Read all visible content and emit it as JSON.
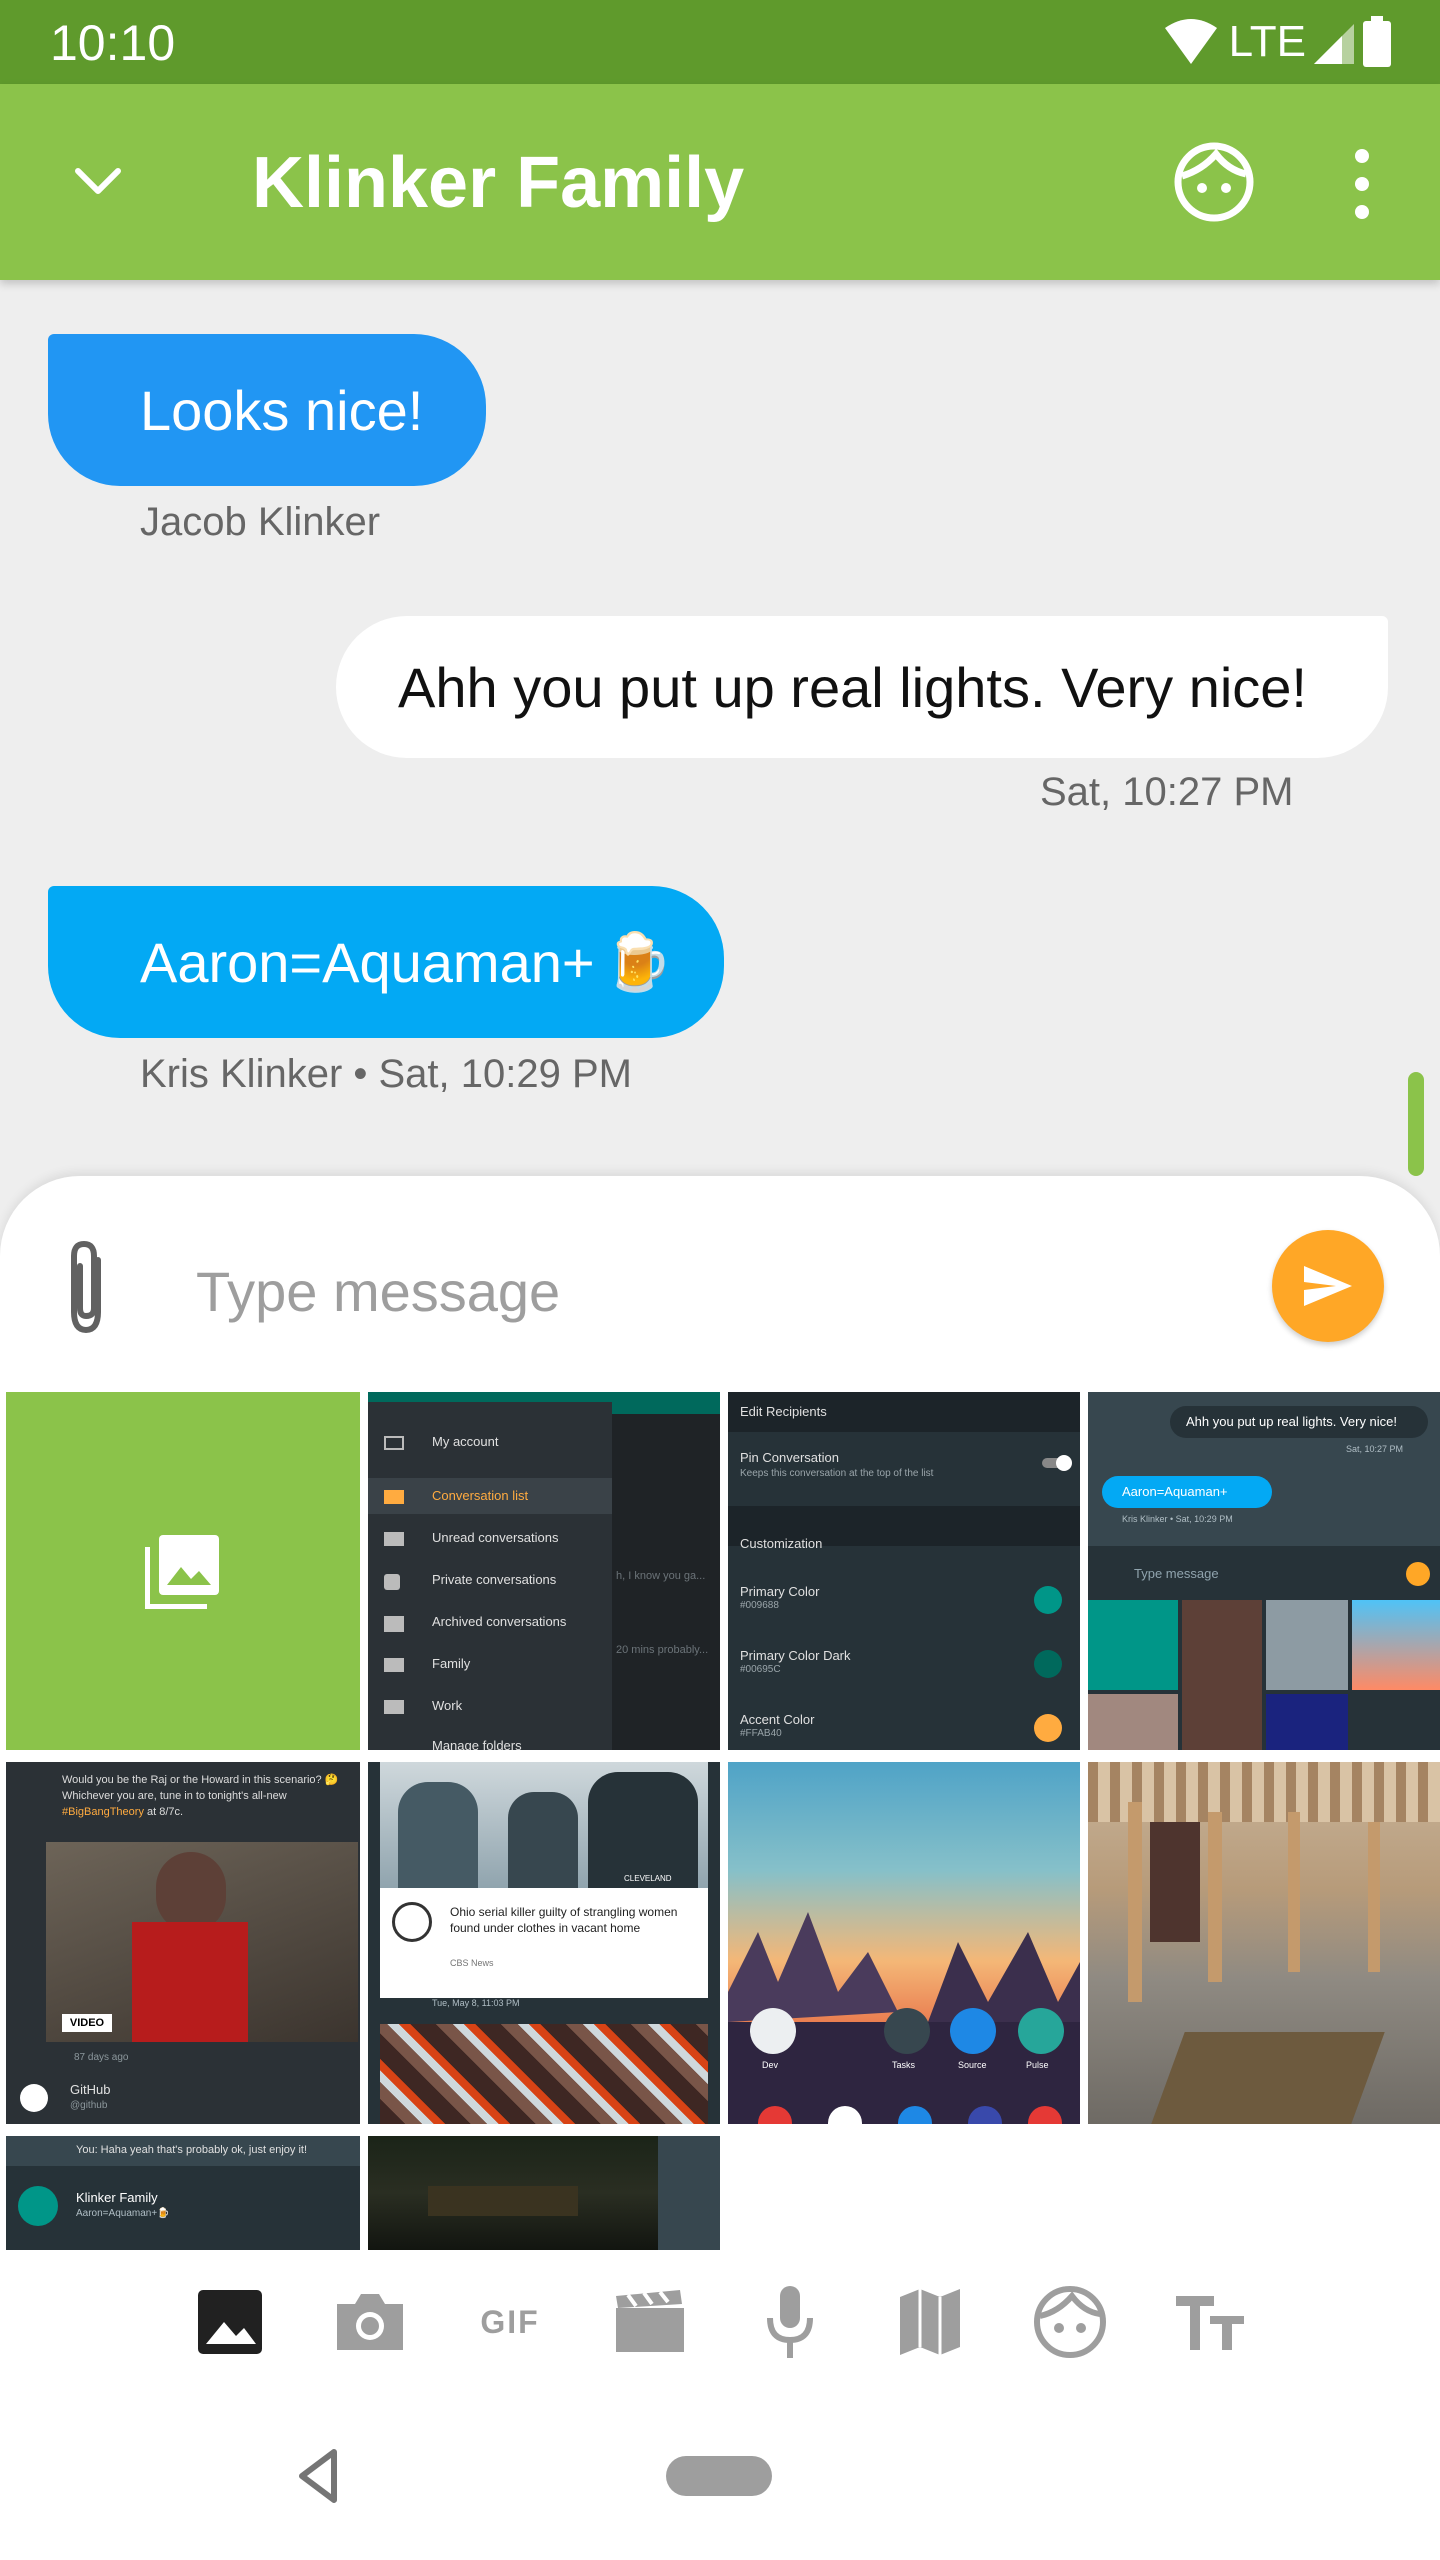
{
  "status_bar": {
    "time": "10:10",
    "network": "LTE"
  },
  "app_bar": {
    "title": "Klinker Family"
  },
  "messages": [
    {
      "text": "Looks nice!",
      "meta": "Jacob Klinker"
    },
    {
      "text": "Ahh you put up real lights. Very nice!",
      "meta": "Sat, 10:27 PM"
    },
    {
      "text": "Aaron=Aquaman+",
      "emoji": "🍺",
      "meta": "Kris Klinker • Sat, 10:29 PM"
    }
  ],
  "compose": {
    "placeholder": "Type message"
  },
  "gallery": {
    "settings_menu": [
      "My account",
      "Conversation list",
      "Unread conversations",
      "Private conversations",
      "Archived conversations",
      "Family",
      "Work",
      "Manage folders"
    ],
    "settings_menu_fragments": [
      "h, I know you ga...",
      "20 mins probably..."
    ],
    "conversation_settings": {
      "header": "Edit Recipients",
      "pin_title": "Pin Conversation",
      "pin_sub": "Keeps this conversation at the top of the list",
      "section": "Customization",
      "items": [
        {
          "label": "Primary Color",
          "value": "#009688",
          "color": "#009688"
        },
        {
          "label": "Primary Color Dark",
          "value": "#00695C",
          "color": "#00695c"
        },
        {
          "label": "Accent Color",
          "value": "#FFAB40",
          "color": "#ffab40"
        }
      ]
    },
    "mini_chat": {
      "out": "Ahh you put up real lights. Very nice!",
      "out_meta": "Sat, 10:27 PM",
      "in": "Aaron=Aquaman+",
      "in_meta": "Kris Klinker • Sat, 10:29 PM",
      "placeholder": "Type message"
    },
    "tweet": {
      "text": "Would you be the Raj or the Howard in this scenario? 🤔 Whichever you are, tune in to tonight's all-new",
      "hashtag": "#BigBangTheory",
      "suffix": " at 8/7c.",
      "badge": "VIDEO",
      "age": "87 days ago",
      "source": "GitHub",
      "handle": "@github"
    },
    "news": {
      "headline": "Ohio serial killer guilty of strangling women found under clothes in vacant home",
      "source": "CBS News",
      "date": "Tue, May 8, 11:03 PM",
      "banner": "CLEVELAND"
    },
    "wallpaper_apps": [
      "Dev",
      "Tasks",
      "Source",
      "Pulse"
    ],
    "notification": {
      "reply": "You: Haha yeah that's probably ok, just enjoy it!",
      "title": "Klinker Family",
      "sub": "Aaron=Aquaman+🍺"
    }
  },
  "colors": {
    "status_bar": "#5f9a2c",
    "app_bar": "#8bc34a",
    "bubble_in": "#2196f3",
    "bubble_in_alt": "#03a9f4",
    "send": "#ffa726"
  },
  "icons": [
    "chevron-down-icon",
    "face-icon",
    "more-vert-icon",
    "paperclip-icon",
    "send-icon",
    "image-icon",
    "camera-icon",
    "gif-icon",
    "video-icon",
    "mic-icon",
    "map-icon",
    "emoji-icon",
    "text-format-icon",
    "nav-back-icon"
  ]
}
